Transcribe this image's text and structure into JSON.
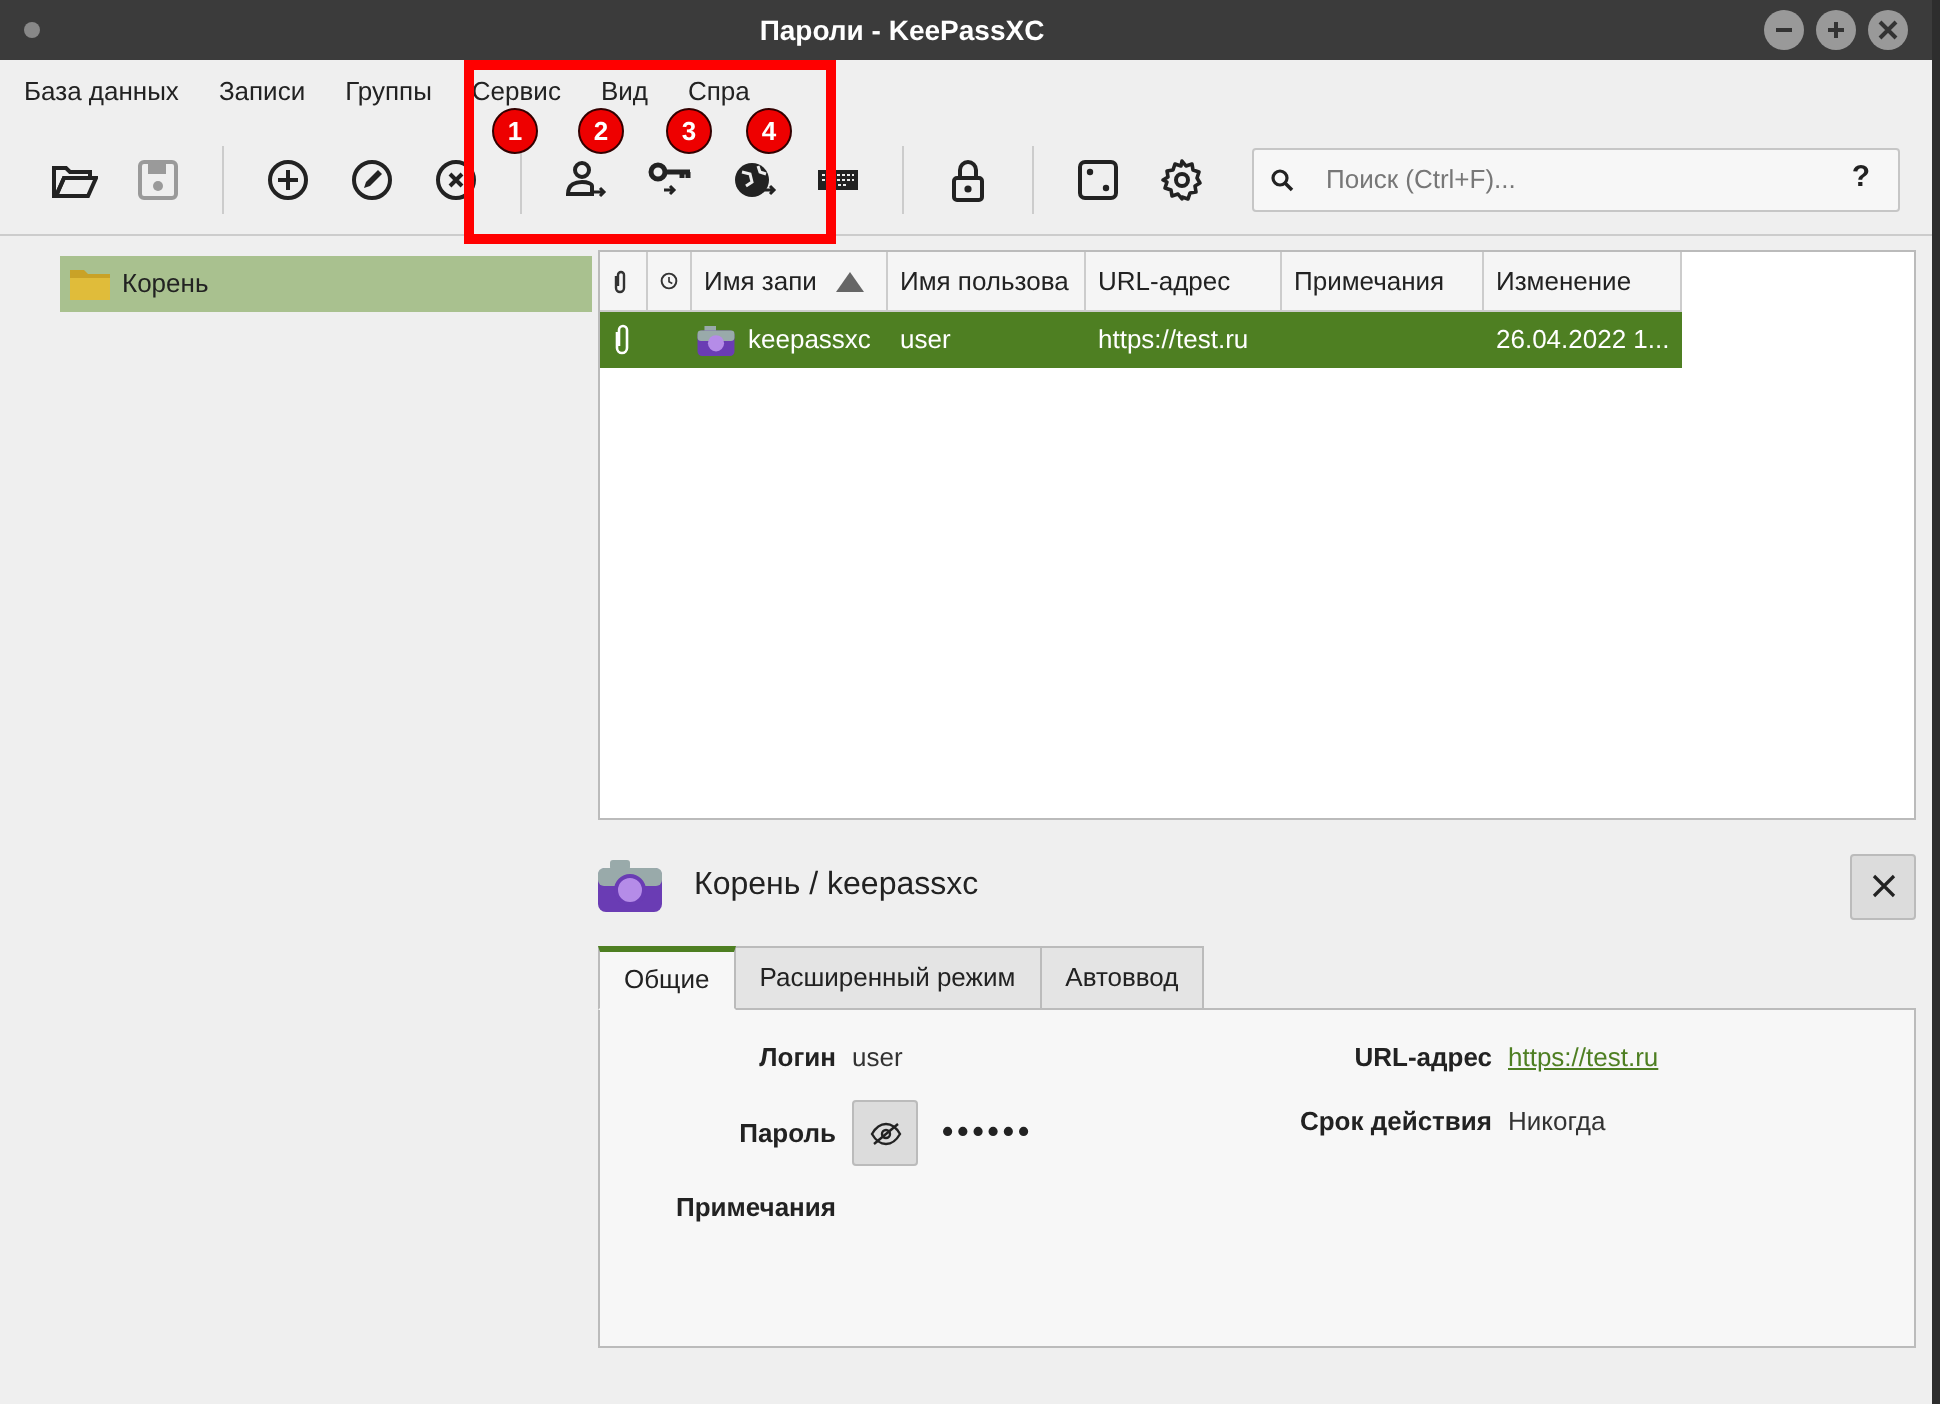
{
  "window": {
    "title": "Пароли - KeePassXC"
  },
  "menu": [
    {
      "label": "База данных"
    },
    {
      "label": "Записи"
    },
    {
      "label": "Группы"
    },
    {
      "label": "Сервис"
    },
    {
      "label": "Вид"
    },
    {
      "label": "Спра"
    }
  ],
  "toolbar": [
    {
      "kind": "open",
      "disabled": false
    },
    {
      "kind": "save",
      "disabled": true
    },
    {
      "kind": "sep"
    },
    {
      "kind": "add",
      "disabled": false
    },
    {
      "kind": "edit",
      "disabled": false
    },
    {
      "kind": "delete",
      "disabled": false
    },
    {
      "kind": "sep"
    },
    {
      "kind": "user",
      "disabled": false
    },
    {
      "kind": "key",
      "disabled": false
    },
    {
      "kind": "globe",
      "disabled": false
    },
    {
      "kind": "keyboard",
      "disabled": false
    },
    {
      "kind": "sep"
    },
    {
      "kind": "lock",
      "disabled": false
    },
    {
      "kind": "sep"
    },
    {
      "kind": "dice",
      "disabled": false
    },
    {
      "kind": "gear",
      "disabled": false
    }
  ],
  "annotations": [
    {
      "label": "1"
    },
    {
      "label": "2"
    },
    {
      "label": "3"
    },
    {
      "label": "4"
    }
  ],
  "search": {
    "placeholder": "Поиск (Ctrl+F)...",
    "help": "?"
  },
  "groups": [
    {
      "label": "Корень",
      "selected": true
    }
  ],
  "table": {
    "columns": [
      {
        "kind": "attach"
      },
      {
        "kind": "clock"
      },
      {
        "label": "Имя запи",
        "sorted": true
      },
      {
        "label": "Имя пользова"
      },
      {
        "label": "URL-адрес"
      },
      {
        "label": "Примечания"
      },
      {
        "label": "Изменение"
      }
    ],
    "rows": [
      {
        "selected": true,
        "attachment": true,
        "title": "keepassxc",
        "username": "user",
        "url": "https://test.ru",
        "modified": "26.04.2022 1..."
      }
    ]
  },
  "details": {
    "title": "Корень / keepassxc",
    "tabs": [
      {
        "label": "Общие",
        "selected": true
      },
      {
        "label": "Расширенный режим",
        "selected": false
      },
      {
        "label": "Автоввод",
        "selected": false
      }
    ],
    "left": [
      {
        "label": "Логин",
        "kind": "text",
        "value": "user"
      },
      {
        "label": "Пароль",
        "kind": "password",
        "value": "••••••"
      },
      {
        "label": "Примечания",
        "kind": "text"
      }
    ],
    "right": [
      {
        "label": "URL-адрес",
        "kind": "link",
        "value": "https://test.ru"
      },
      {
        "label": "Срок действия",
        "kind": "text",
        "value": "Никогда"
      }
    ]
  }
}
